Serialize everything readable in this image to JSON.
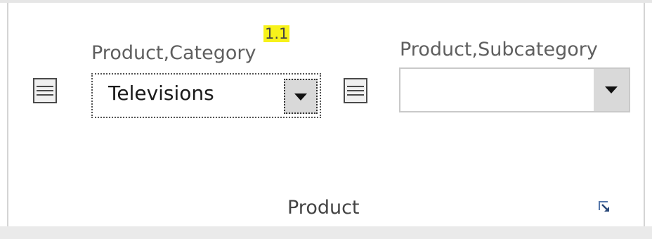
{
  "group": {
    "title": "Product"
  },
  "category": {
    "label": "Product,Category",
    "keytip": "1.1",
    "value": "Televisions"
  },
  "subcategory": {
    "label": "Product,Subcategory",
    "value": ""
  },
  "icons": {
    "handle": "list-handle-icon",
    "dropdown": "chevron-down-icon",
    "launcher": "dialog-launcher-icon"
  }
}
